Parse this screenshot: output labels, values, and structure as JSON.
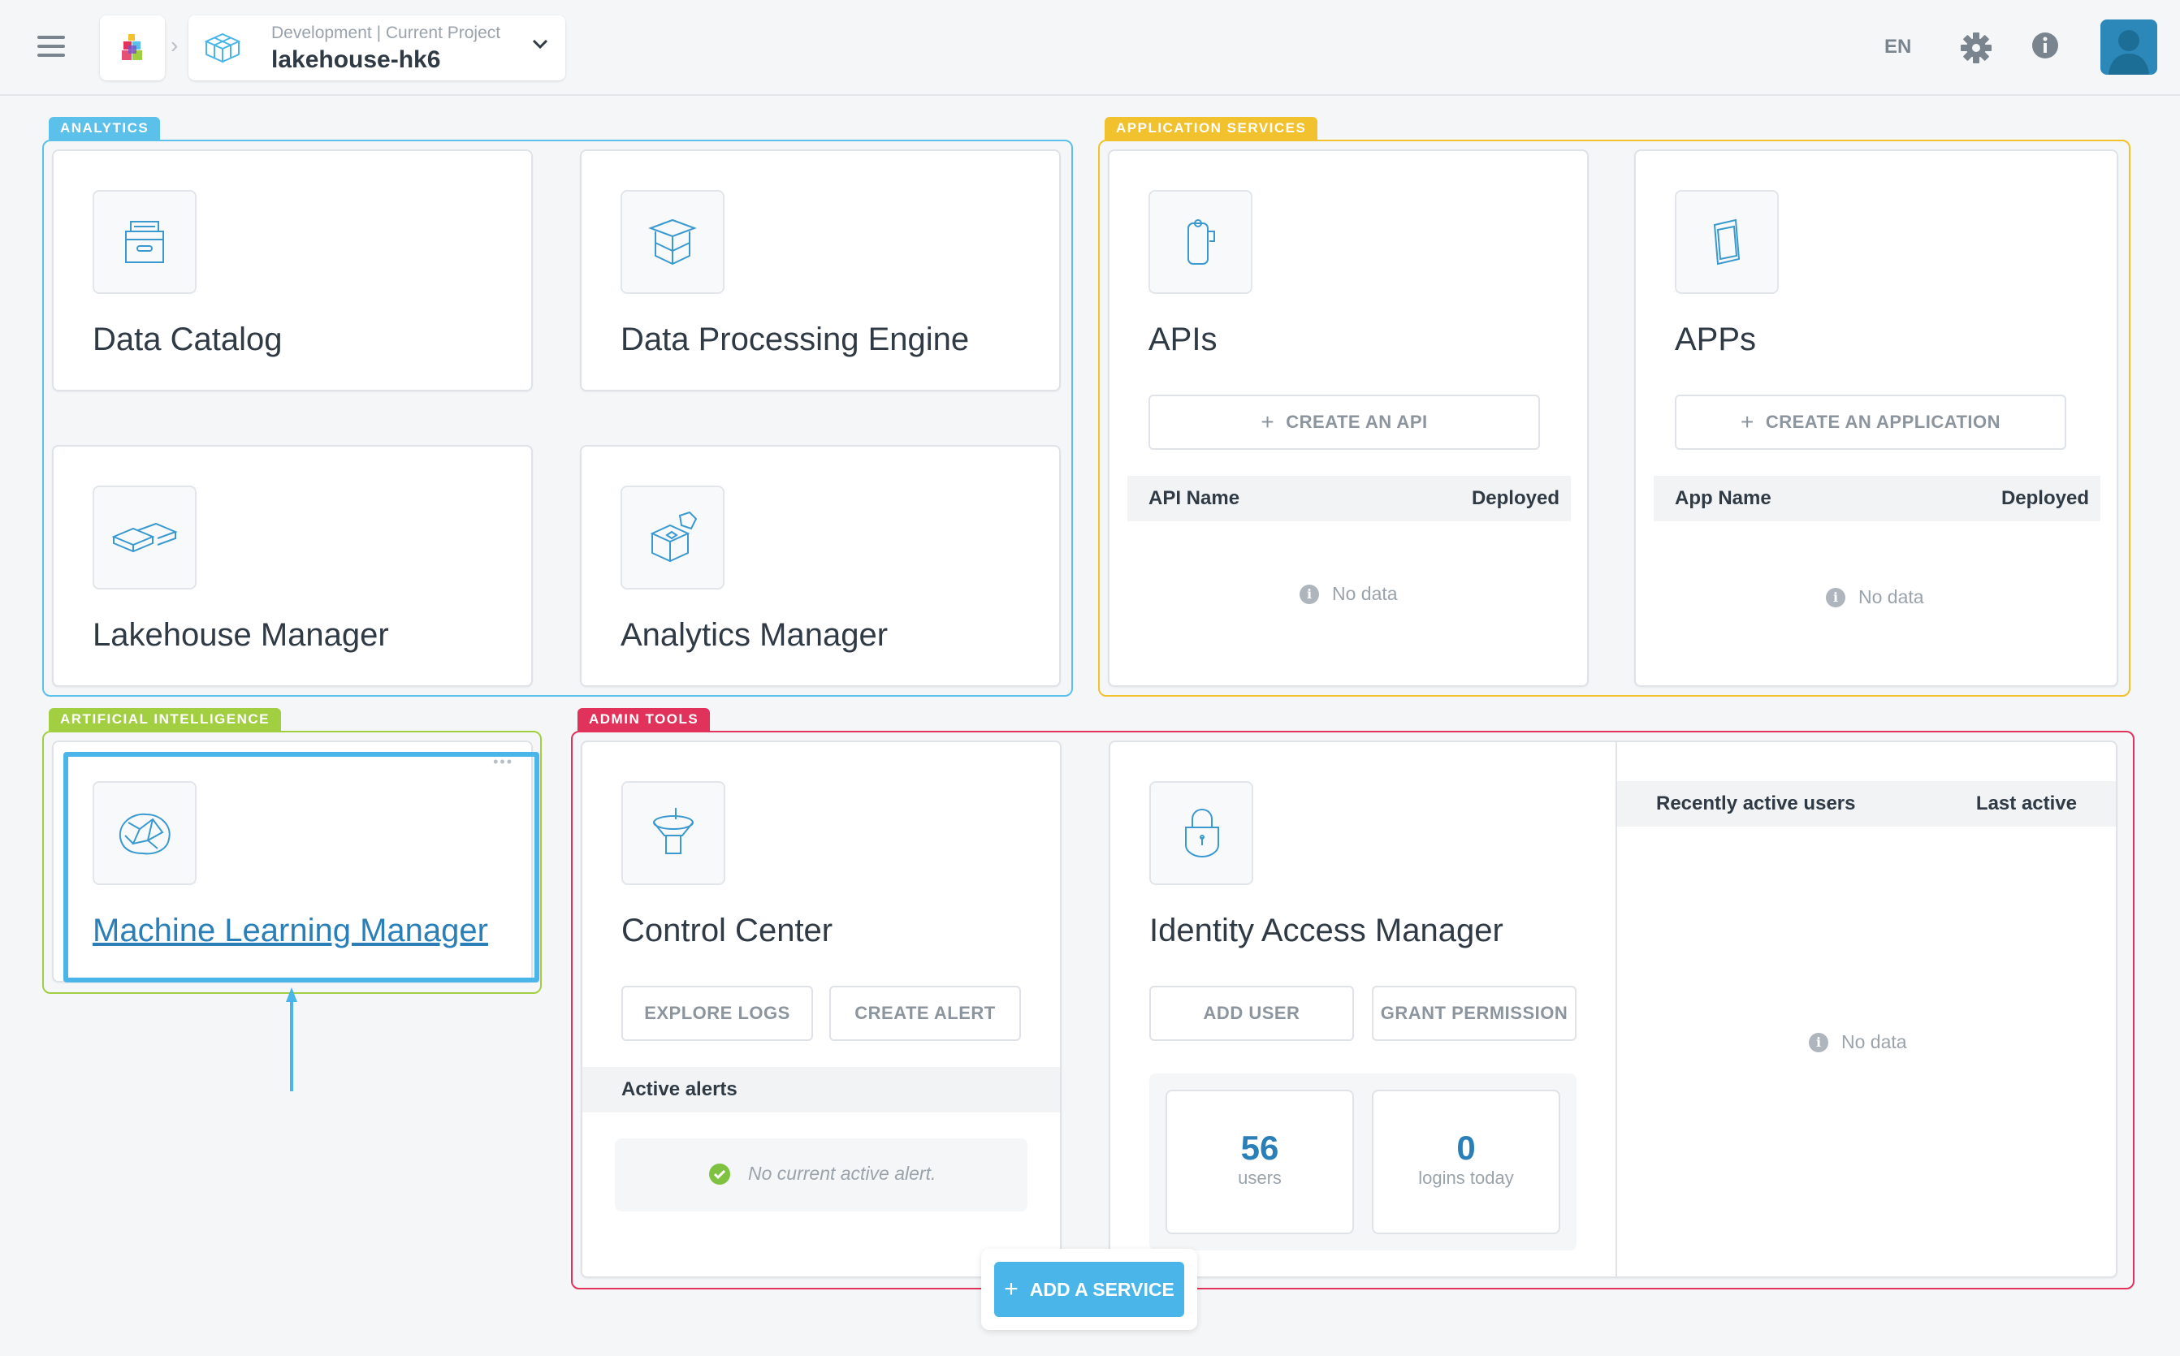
{
  "header": {
    "environment": "Development",
    "environment_sep": "|",
    "environment_label": "Current Project",
    "project_name": "lakehouse-hk6",
    "language": "EN",
    "icons": [
      "menu-icon",
      "app-logo-icon",
      "project-cube-icon",
      "chevron-down-icon",
      "settings-gear-icon",
      "info-icon",
      "user-avatar-icon"
    ]
  },
  "groups": {
    "analytics": "ANALYTICS",
    "application_services": "APPLICATION SERVICES",
    "artificial_intelligence": "ARTIFICIAL INTELLIGENCE",
    "admin_tools": "ADMIN TOOLS"
  },
  "cards": {
    "data_catalog": {
      "title": "Data Catalog"
    },
    "data_processing_engine": {
      "title": "Data Processing Engine"
    },
    "lakehouse_manager": {
      "title": "Lakehouse Manager"
    },
    "analytics_manager": {
      "title": "Analytics Manager"
    },
    "apis": {
      "title": "APIs",
      "create_button": "CREATE AN API",
      "col_name": "API Name",
      "col_deployed": "Deployed",
      "empty": "No data"
    },
    "apps": {
      "title": "APPs",
      "create_button": "CREATE AN APPLICATION",
      "col_name": "App Name",
      "col_deployed": "Deployed",
      "empty": "No data"
    },
    "machine_learning_manager": {
      "title": "Machine Learning Manager",
      "menu": "•••"
    },
    "control_center": {
      "title": "Control Center",
      "explore_logs": "EXPLORE LOGS",
      "create_alert": "CREATE ALERT",
      "alerts_header": "Active alerts",
      "alerts_empty": "No current active alert."
    },
    "identity_access_manager": {
      "title": "Identity Access Manager",
      "add_user": "ADD USER",
      "grant_permission": "GRANT PERMISSION",
      "users_count": "56",
      "users_label": "users",
      "logins_count": "0",
      "logins_label": "logins today",
      "recent_header": "Recently active users",
      "last_active_header": "Last active",
      "recent_empty": "No data"
    }
  },
  "actions": {
    "add_service": "ADD A SERVICE"
  },
  "colors": {
    "analytics": "#5bc0ea",
    "application_services": "#f2c12e",
    "artificial_intelligence": "#a2cf42",
    "admin_tools": "#e0325b",
    "accent": "#4ab5e8",
    "link": "#2b7fb8"
  }
}
